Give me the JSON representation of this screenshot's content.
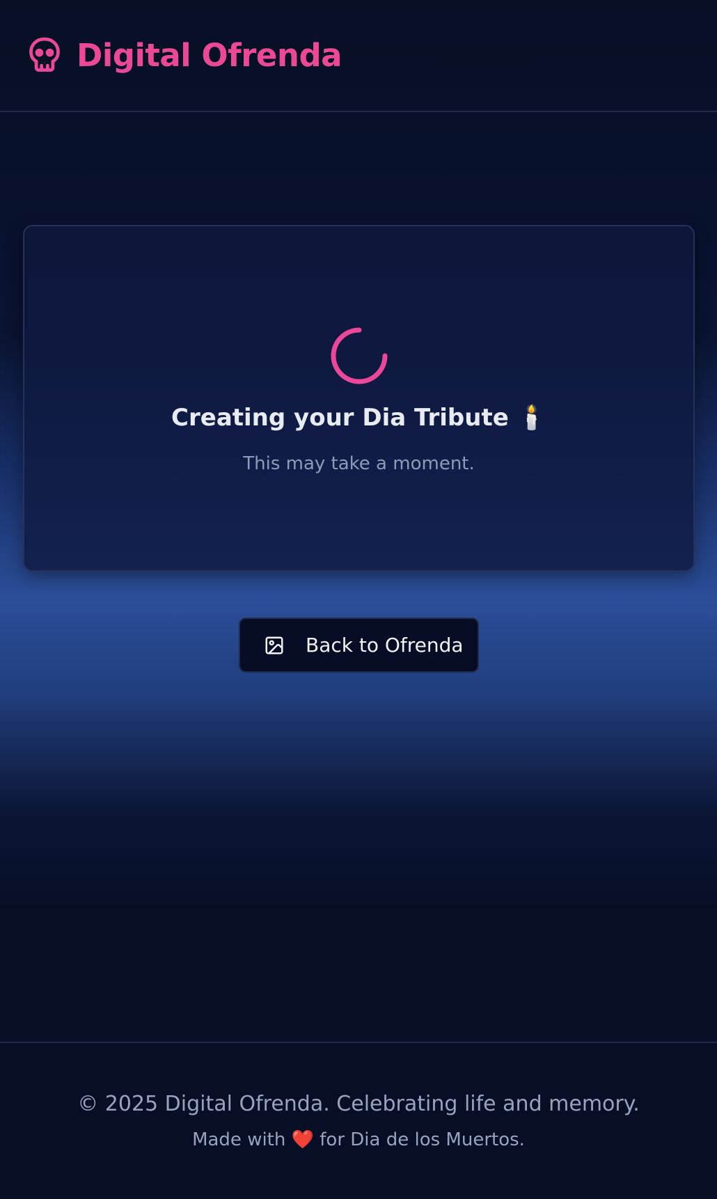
{
  "header": {
    "logo_icon": "skull-icon",
    "title": "Digital Ofrenda"
  },
  "loading_card": {
    "spinner_icon": "loading-spinner-icon",
    "title": "Creating your Dia Tribute 🕯️",
    "subtitle": "This may take a moment."
  },
  "back_button": {
    "icon": "image-icon",
    "label": "Back to Ofrenda"
  },
  "footer": {
    "copyright": "© 2025 Digital Ofrenda. Celebrating life and memory.",
    "made_with_prefix": "Made with",
    "heart": "❤️",
    "made_with_suffix": "for Dia de los Muertos."
  },
  "colors": {
    "accent": "#ec4899",
    "background": "#070f27",
    "card_background": "#0e163a",
    "muted_text": "#8e9bb8"
  }
}
